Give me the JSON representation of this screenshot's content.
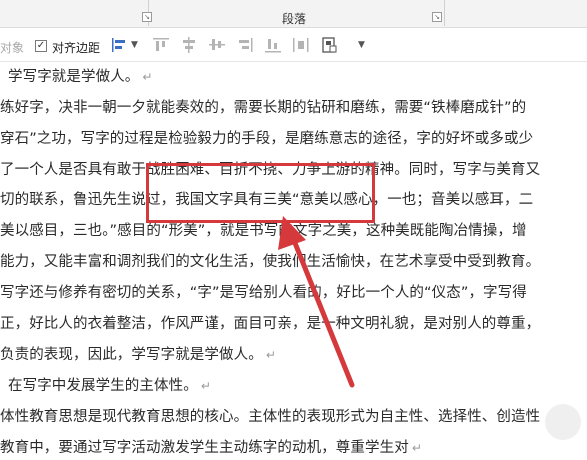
{
  "ribbon": {
    "group_label": "段落",
    "launcher_glyph": "↘"
  },
  "toolbar": {
    "object_label": "对象",
    "align_margin_label": "对齐边距",
    "checkbox_checked": "✓",
    "icons": [
      "align-left-icon",
      "align-top-icon",
      "align-middle-vertical-icon",
      "align-bottom-icon",
      "align-center-horizontal-icon",
      "align-right-icon",
      "distribute-icon",
      "page-position-icon",
      "more-dropdown-icon"
    ]
  },
  "document": {
    "lines": [
      "学写字就是学做人。",
      "练好字，决非一朝一夕就能奏效的，需要长期的钻研和磨练，需要“铁棒磨成针”的",
      "穿石”之功，写字的过程是检验毅力的手段，是磨练意志的途径，字的好坏或多或少",
      "了一个人是否具有敢于战胜困难、百折不挠、力争上游的精神。同时，写字与美育又",
      "切的联系，鲁迅先生说过，我国文字具有三美“意美以感心，一也；音美以感耳，二",
      "美以感目，三也。”感目的“形美”，就是书写的文字之美，这种美既能陶冶情操，增",
      "能力，又能丰富和调剂我们的文化生活，使我们生活愉快，在艺术享受中受到教育。",
      "写字还与修养有密切的关系，“字”是写给别人看的，好比一个人的“仪态”，字写得",
      "正，好比人的衣着整洁，作风严谨，面目可亲，是一种文明礼貌，是对别人的尊重，",
      "负责的表现，因此，学写字就是学做人。",
      "在写字中发展学生的主体性。",
      "体性教育思想是现代教育思想的核心。主体性的表现形式为自主性、选择性、创造性",
      "教育中，要通过写字活动激发学生主动练字的动机，尊重学生对"
    ],
    "paragraph_mark": "↵"
  },
  "annotation": {
    "color": "#d6393c"
  }
}
